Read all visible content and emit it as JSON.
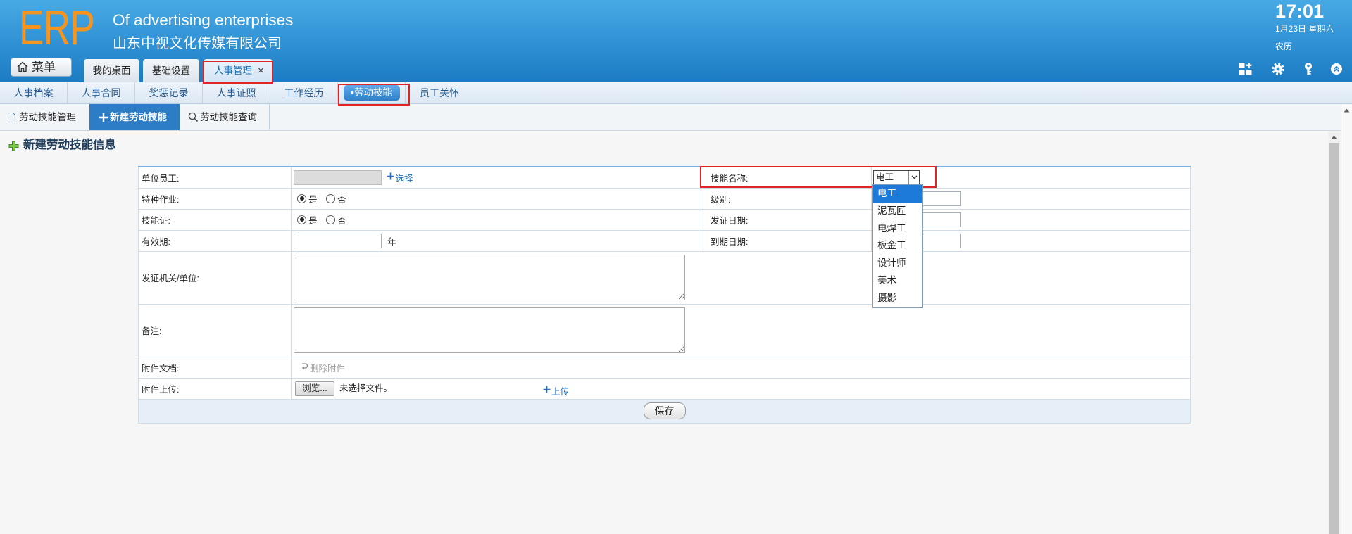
{
  "header": {
    "logo": "ERP",
    "slogan": "Of advertising enterprises",
    "company": "山东中视文化传媒有限公司",
    "clock": {
      "time": "17:01",
      "date": "1月23日 星期六",
      "lunar": "农历"
    },
    "menu_button": {
      "label": "菜单",
      "icon": "home-icon"
    },
    "tabs": [
      {
        "label": "我的桌面",
        "active": false
      },
      {
        "label": "基础设置",
        "active": false
      },
      {
        "label": "人事管理",
        "active": true,
        "close": "×"
      }
    ],
    "tools": [
      "apps-add-icon",
      "gear-icon",
      "key-icon",
      "collapse-up-icon"
    ]
  },
  "module_nav": {
    "items": [
      "人事档案",
      "人事合同",
      "奖惩记录",
      "人事证照",
      "工作经历",
      "•劳动技能",
      "员工关怀"
    ],
    "active_index": 5
  },
  "sub_tabs": [
    {
      "label": "劳动技能管理",
      "icon": "document-icon",
      "active": false
    },
    {
      "label": "新建劳动技能",
      "icon": "plus-icon",
      "active": true
    },
    {
      "label": "劳动技能查询",
      "icon": "search-icon",
      "active": false
    }
  ],
  "page_title": "新建劳动技能信息",
  "form": {
    "employee": {
      "label": "单位员工:",
      "value": "",
      "select_link": "选择"
    },
    "skill_name": {
      "label": "技能名称:",
      "value": "电工",
      "options": [
        "电工",
        "泥瓦匠",
        "电焊工",
        "板金工",
        "设计师",
        "美术",
        "摄影"
      ],
      "highlighted_index": 0
    },
    "special_operation": {
      "label": "特种作业:",
      "options": [
        "是",
        "否"
      ],
      "selected_index": 0
    },
    "level": {
      "label": "级别:",
      "value": ""
    },
    "certificate": {
      "label": "技能证:",
      "options": [
        "是",
        "否"
      ],
      "selected_index": 0
    },
    "issue_date": {
      "label": "发证日期:",
      "value": ""
    },
    "validity": {
      "label": "有效期:",
      "value": "",
      "unit": "年"
    },
    "expiry_date": {
      "label": "到期日期:",
      "value": ""
    },
    "issuer": {
      "label": "发证机关/单位:",
      "value": ""
    },
    "remark": {
      "label": "备注:",
      "value": ""
    },
    "attachments": {
      "label": "附件文档:",
      "delete_link": "删除附件"
    },
    "upload": {
      "label": "附件上传:",
      "browse_button": "浏览...",
      "file_status": "未选择文件。",
      "upload_link": "上传"
    },
    "save_button": "保存"
  },
  "colors": {
    "header_top": "#48aae4",
    "header_bottom": "#1c7bc2",
    "logo": "#f7941d",
    "active_sub_tab": "#2c7dc5",
    "link": "#2a6fb7",
    "dropdown_highlight": "#1e7ad8",
    "annotation_red": "#e02424"
  }
}
